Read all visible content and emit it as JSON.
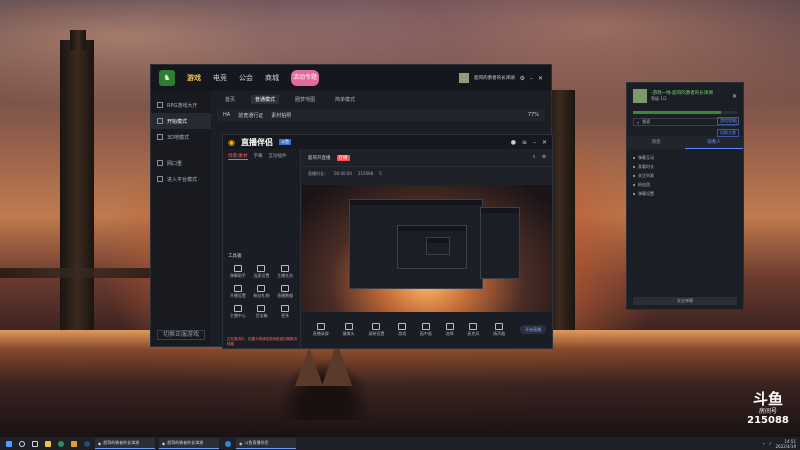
{
  "client": {
    "nav": [
      "游戏",
      "电竞",
      "公会",
      "商城"
    ],
    "mascot": "活动专题",
    "user": "超哥的勇者的长津湖",
    "side": [
      "RPG游戏大厅",
      "开始模式",
      "3D地模式",
      "网口重",
      "进入平台模式"
    ],
    "switch": "切换正服游戏",
    "tabs": [
      "首页",
      "普通模式",
      "圈梦地图",
      "简单模式"
    ],
    "settings": [
      "HA",
      "前宽通行证",
      "素材拍照",
      "77%"
    ]
  },
  "obs": {
    "brand": "直播伴侣",
    "brand_badge": "斗鱼",
    "left_tabs": [
      "场景/素材",
      "字幕",
      "互动插件"
    ],
    "room_title": "超哥开直播",
    "live": "在播",
    "stats": [
      "直播时长：",
      "00:00:00",
      "215088",
      "5"
    ],
    "tool_section": "工具箱",
    "tools": [
      "弹幕助手",
      "连麦设置",
      "主播任务",
      "开播设置",
      "粉丝礼物",
      "直播数据",
      "主播中心",
      "百宝箱",
      "更多"
    ],
    "bottom": [
      "直播录屏",
      "摄像头",
      "录制设置",
      "游戏",
      "画中画",
      "选择",
      "麦克风",
      "扬声器"
    ],
    "golive": "开始直播",
    "footer": "正在推流中，如遇卡顿请检查网络或切换推流线路"
  },
  "chat": {
    "game_title": "-游戏一线-超哥的勇者的长津湖",
    "game_sub": "等级",
    "level": "1/2",
    "search": "搜索",
    "link1": "游戏攻略",
    "link2": "切换主题",
    "tabs": [
      "消息",
      "观看人"
    ],
    "items": [
      "弹幕互动",
      "观看时长",
      "关注列表",
      "粉丝团",
      "弹幕设置"
    ],
    "send": "发送弹幕"
  },
  "watermark": {
    "line1": "斗鱼",
    "line2": "房间号",
    "room": "215088"
  },
  "taskbar": {
    "apps": [
      "超哥的勇者的长津湖",
      "超哥的勇者的长津湖",
      "斗鱼直播伴侣"
    ],
    "time": "14:51",
    "date": "2022/4/19"
  }
}
